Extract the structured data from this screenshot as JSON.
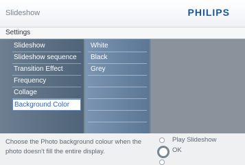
{
  "header": {
    "title": "Slideshow",
    "brand": "PHILIPS"
  },
  "settings": {
    "label": "Settings"
  },
  "menu": {
    "items": [
      {
        "label": "Slideshow"
      },
      {
        "label": "Slideshow sequence"
      },
      {
        "label": "Transition Effect"
      },
      {
        "label": "Frequency"
      },
      {
        "label": "Collage"
      },
      {
        "label": "Background Color",
        "selected": true
      }
    ]
  },
  "options": {
    "items": [
      {
        "label": "White"
      },
      {
        "label": "Black"
      },
      {
        "label": "Grey"
      }
    ]
  },
  "footer": {
    "hint": "Choose the Photo background colour when the photo doesn't fill the entire display.",
    "play_label": "Play Slideshow",
    "ok_label": "OK"
  },
  "colors": {
    "brand": "#1a57a0",
    "selection_text": "#2a64b8"
  }
}
